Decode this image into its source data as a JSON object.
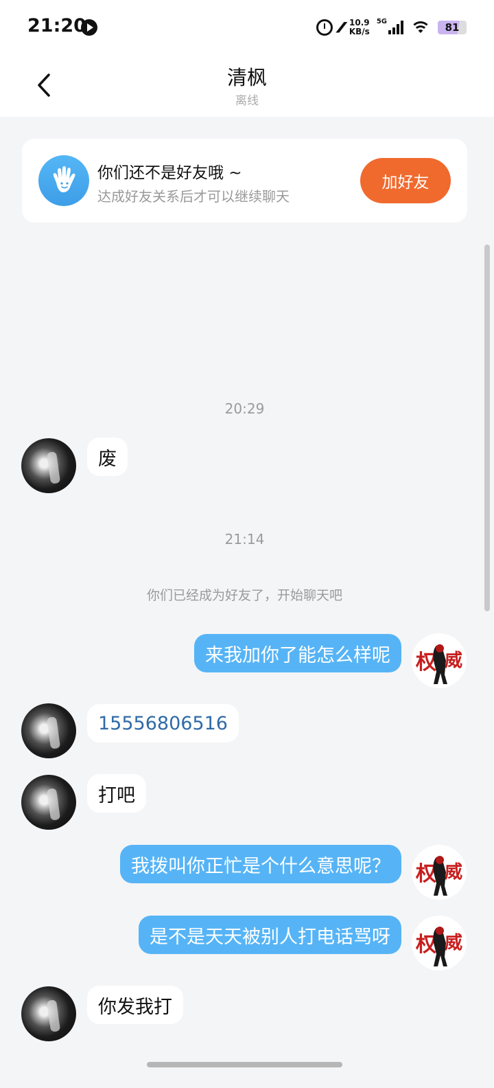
{
  "status_bar": {
    "time": "21:20",
    "speed_value": "10.9",
    "speed_unit": "KB/s",
    "network": "5G",
    "battery": "81"
  },
  "header": {
    "title": "清枫",
    "subtitle": "离线"
  },
  "friend_card": {
    "title": "你们还不是好友哦 ~",
    "subtitle": "达成好友关系后才可以继续聊天",
    "button_label": "加好友"
  },
  "messages": {
    "ts1": "20:29",
    "m1": "废",
    "ts2": "21:14",
    "system": "你们已经成为好友了，开始聊天吧",
    "m2": "来我加你了能怎么样呢",
    "m3": "15556806516",
    "m4": "打吧",
    "m5": "我拨叫你正忙是个什么意思呢？",
    "m6": "是不是天天被别人打电话骂呀",
    "m7": "你发我打"
  },
  "icons": {
    "back": "chevron-left-icon",
    "hand": "hand-wave-icon",
    "alarm": "alarm-icon",
    "wifi": "wifi-icon",
    "signal": "signal-icon",
    "battery": "battery-icon"
  },
  "colors": {
    "accent_orange": "#f06a2e",
    "bubble_blue": "#56b4f6",
    "link_blue": "#2f6aa6",
    "background": "#f4f5f7"
  }
}
